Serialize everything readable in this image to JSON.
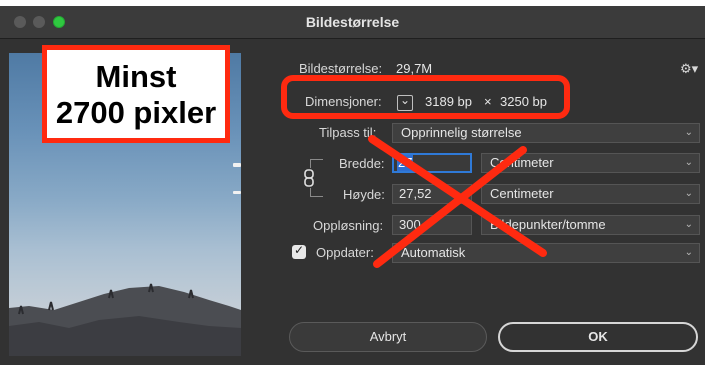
{
  "window": {
    "title": "Bildestørrelse"
  },
  "overlay_text": {
    "line1": "Minst",
    "line2": "2700 pixler"
  },
  "info": {
    "size_label": "Bildestørrelse:",
    "size_value": "29,7M",
    "dimensions_label": "Dimensjoner:",
    "dimensions_width": "3189 bp",
    "dimensions_sep": "×",
    "dimensions_height": "3250 bp"
  },
  "fit": {
    "label": "Tilpass til:",
    "value": "Opprinnelig størrelse"
  },
  "width": {
    "label": "Bredde:",
    "value": "27",
    "unit": "Centimeter"
  },
  "height": {
    "label": "Høyde:",
    "value": "27,52",
    "unit": "Centimeter"
  },
  "resolution": {
    "label": "Oppløsning:",
    "value": "300",
    "unit": "Bildepunkter/tomme"
  },
  "resample": {
    "label": "Oppdater:",
    "checked": true,
    "value": "Automatisk"
  },
  "buttons": {
    "cancel": "Avbryt",
    "ok": "OK"
  },
  "colors": {
    "annotation_red": "#ff2a10",
    "accent_blue": "#2f7ad8",
    "dialog_bg": "#323232"
  },
  "icons": [
    "settings-gear-icon",
    "checkmark-icon",
    "chain-link-icon",
    "chevron-down-icon"
  ]
}
